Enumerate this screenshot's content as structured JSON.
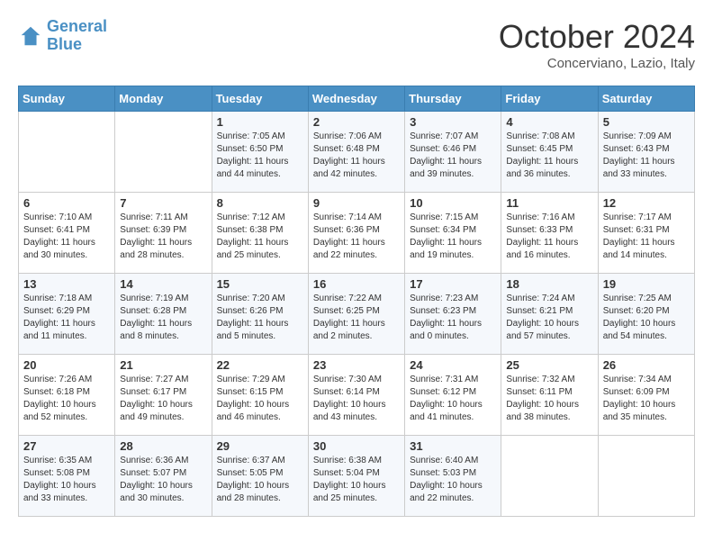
{
  "header": {
    "logo_line1": "General",
    "logo_line2": "Blue",
    "month": "October 2024",
    "location": "Concerviano, Lazio, Italy"
  },
  "weekdays": [
    "Sunday",
    "Monday",
    "Tuesday",
    "Wednesday",
    "Thursday",
    "Friday",
    "Saturday"
  ],
  "weeks": [
    [
      {
        "day": "",
        "info": ""
      },
      {
        "day": "",
        "info": ""
      },
      {
        "day": "1",
        "info": "Sunrise: 7:05 AM\nSunset: 6:50 PM\nDaylight: 11 hours and 44 minutes."
      },
      {
        "day": "2",
        "info": "Sunrise: 7:06 AM\nSunset: 6:48 PM\nDaylight: 11 hours and 42 minutes."
      },
      {
        "day": "3",
        "info": "Sunrise: 7:07 AM\nSunset: 6:46 PM\nDaylight: 11 hours and 39 minutes."
      },
      {
        "day": "4",
        "info": "Sunrise: 7:08 AM\nSunset: 6:45 PM\nDaylight: 11 hours and 36 minutes."
      },
      {
        "day": "5",
        "info": "Sunrise: 7:09 AM\nSunset: 6:43 PM\nDaylight: 11 hours and 33 minutes."
      }
    ],
    [
      {
        "day": "6",
        "info": "Sunrise: 7:10 AM\nSunset: 6:41 PM\nDaylight: 11 hours and 30 minutes."
      },
      {
        "day": "7",
        "info": "Sunrise: 7:11 AM\nSunset: 6:39 PM\nDaylight: 11 hours and 28 minutes."
      },
      {
        "day": "8",
        "info": "Sunrise: 7:12 AM\nSunset: 6:38 PM\nDaylight: 11 hours and 25 minutes."
      },
      {
        "day": "9",
        "info": "Sunrise: 7:14 AM\nSunset: 6:36 PM\nDaylight: 11 hours and 22 minutes."
      },
      {
        "day": "10",
        "info": "Sunrise: 7:15 AM\nSunset: 6:34 PM\nDaylight: 11 hours and 19 minutes."
      },
      {
        "day": "11",
        "info": "Sunrise: 7:16 AM\nSunset: 6:33 PM\nDaylight: 11 hours and 16 minutes."
      },
      {
        "day": "12",
        "info": "Sunrise: 7:17 AM\nSunset: 6:31 PM\nDaylight: 11 hours and 14 minutes."
      }
    ],
    [
      {
        "day": "13",
        "info": "Sunrise: 7:18 AM\nSunset: 6:29 PM\nDaylight: 11 hours and 11 minutes."
      },
      {
        "day": "14",
        "info": "Sunrise: 7:19 AM\nSunset: 6:28 PM\nDaylight: 11 hours and 8 minutes."
      },
      {
        "day": "15",
        "info": "Sunrise: 7:20 AM\nSunset: 6:26 PM\nDaylight: 11 hours and 5 minutes."
      },
      {
        "day": "16",
        "info": "Sunrise: 7:22 AM\nSunset: 6:25 PM\nDaylight: 11 hours and 2 minutes."
      },
      {
        "day": "17",
        "info": "Sunrise: 7:23 AM\nSunset: 6:23 PM\nDaylight: 11 hours and 0 minutes."
      },
      {
        "day": "18",
        "info": "Sunrise: 7:24 AM\nSunset: 6:21 PM\nDaylight: 10 hours and 57 minutes."
      },
      {
        "day": "19",
        "info": "Sunrise: 7:25 AM\nSunset: 6:20 PM\nDaylight: 10 hours and 54 minutes."
      }
    ],
    [
      {
        "day": "20",
        "info": "Sunrise: 7:26 AM\nSunset: 6:18 PM\nDaylight: 10 hours and 52 minutes."
      },
      {
        "day": "21",
        "info": "Sunrise: 7:27 AM\nSunset: 6:17 PM\nDaylight: 10 hours and 49 minutes."
      },
      {
        "day": "22",
        "info": "Sunrise: 7:29 AM\nSunset: 6:15 PM\nDaylight: 10 hours and 46 minutes."
      },
      {
        "day": "23",
        "info": "Sunrise: 7:30 AM\nSunset: 6:14 PM\nDaylight: 10 hours and 43 minutes."
      },
      {
        "day": "24",
        "info": "Sunrise: 7:31 AM\nSunset: 6:12 PM\nDaylight: 10 hours and 41 minutes."
      },
      {
        "day": "25",
        "info": "Sunrise: 7:32 AM\nSunset: 6:11 PM\nDaylight: 10 hours and 38 minutes."
      },
      {
        "day": "26",
        "info": "Sunrise: 7:34 AM\nSunset: 6:09 PM\nDaylight: 10 hours and 35 minutes."
      }
    ],
    [
      {
        "day": "27",
        "info": "Sunrise: 6:35 AM\nSunset: 5:08 PM\nDaylight: 10 hours and 33 minutes."
      },
      {
        "day": "28",
        "info": "Sunrise: 6:36 AM\nSunset: 5:07 PM\nDaylight: 10 hours and 30 minutes."
      },
      {
        "day": "29",
        "info": "Sunrise: 6:37 AM\nSunset: 5:05 PM\nDaylight: 10 hours and 28 minutes."
      },
      {
        "day": "30",
        "info": "Sunrise: 6:38 AM\nSunset: 5:04 PM\nDaylight: 10 hours and 25 minutes."
      },
      {
        "day": "31",
        "info": "Sunrise: 6:40 AM\nSunset: 5:03 PM\nDaylight: 10 hours and 22 minutes."
      },
      {
        "day": "",
        "info": ""
      },
      {
        "day": "",
        "info": ""
      }
    ]
  ]
}
